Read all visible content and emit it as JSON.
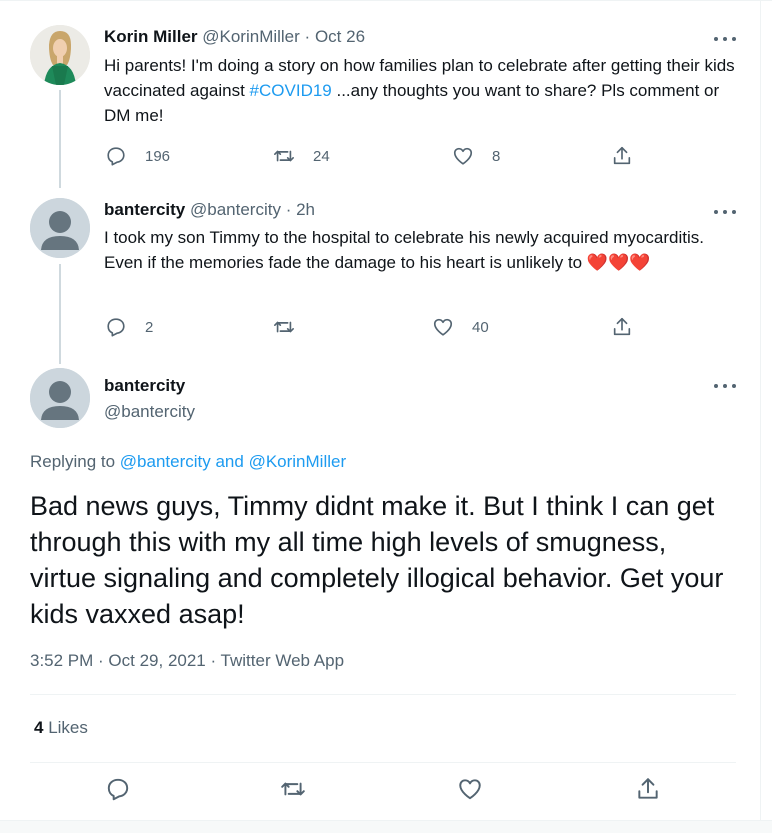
{
  "tweets": [
    {
      "name": "Korin Miller",
      "handle": "@KorinMiller",
      "separator": "·",
      "time": "Oct 26",
      "text_before": "Hi parents! I'm doing a story on how families plan to celebrate after getting their kids vaccinated against ",
      "hashtag": "#COVID19",
      "text_after": " ...any thoughts you want to share? Pls comment or DM me!",
      "replies": "196",
      "retweets": "24",
      "likes": "8"
    },
    {
      "name": "bantercity",
      "handle": "@bantercity",
      "separator": "·",
      "time": "2h",
      "text": "I took my son Timmy to the hospital to celebrate his newly acquired myocarditis. Even if the memories fade the damage to his heart is unlikely to ",
      "emoji": "❤️❤️❤️",
      "replies": "2",
      "retweets": "",
      "likes": "40"
    }
  ],
  "main": {
    "name": "bantercity",
    "handle": "@bantercity",
    "replying_prefix": "Replying to ",
    "replying_user1": "@bantercity",
    "replying_and": " and ",
    "replying_user2": "@KorinMiller",
    "text": "Bad news guys, Timmy didnt make it. But I think I can get through this with my all time high levels of smugness, virtue signaling and completely illogical behavior. Get your kids vaxxed asap!",
    "meta": "3:52 PM · Oct 29, 2021 · Twitter Web App",
    "likes_count": "4",
    "likes_label": " Likes"
  },
  "colors": {
    "accent": "#1d9bf0",
    "muted": "#536471",
    "heart": "#f91880"
  },
  "icons": [
    "reply-icon",
    "retweet-icon",
    "like-icon",
    "share-icon",
    "more-icon",
    "red-heart-emoji"
  ]
}
